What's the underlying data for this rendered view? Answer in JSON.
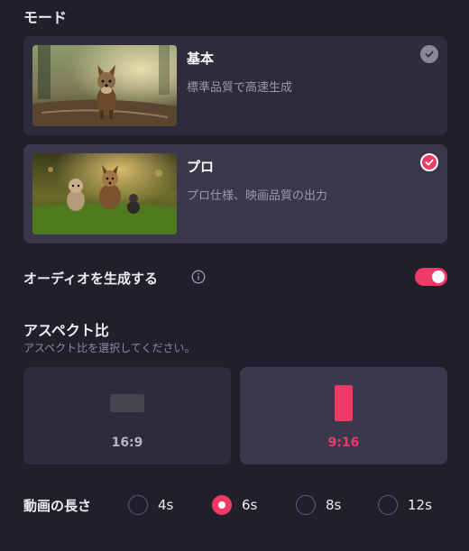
{
  "mode": {
    "title": "モード",
    "options": [
      {
        "name": "基本",
        "description": "標準品質で高速生成",
        "selected": false
      },
      {
        "name": "プロ",
        "description": "プロ仕様、映画品質の出力",
        "selected": true
      }
    ]
  },
  "audio": {
    "label": "オーディオを生成する",
    "enabled": true
  },
  "aspect": {
    "title": "アスペクト比",
    "subtitle": "アスペクト比を選択してください。",
    "options": [
      {
        "label": "16:9",
        "selected": false
      },
      {
        "label": "9:16",
        "selected": true
      }
    ]
  },
  "duration": {
    "label": "動画の長さ",
    "options": [
      {
        "label": "4s",
        "selected": false
      },
      {
        "label": "6s",
        "selected": true
      },
      {
        "label": "8s",
        "selected": false
      },
      {
        "label": "12s",
        "selected": false
      }
    ]
  },
  "colors": {
    "accent": "#ee3a66",
    "background": "#211f2c",
    "card": "#2e2c3b",
    "card_selected": "#3b384c"
  }
}
